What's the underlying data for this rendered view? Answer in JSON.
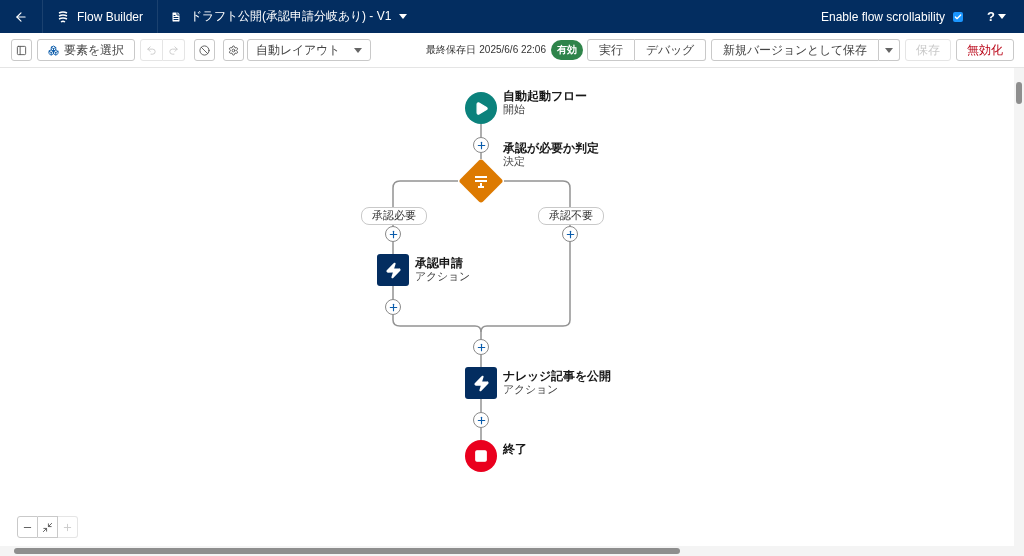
{
  "header": {
    "app_name": "Flow Builder",
    "flow_title": "ドラフト公開(承認申請分岐あり) - V1",
    "scrollability": {
      "label": "Enable flow scrollability",
      "checked": true
    },
    "help": "?"
  },
  "toolbar": {
    "select_button": "要素を選択",
    "undo_disabled": true,
    "redo_disabled": true,
    "layout": "自動レイアウト",
    "last_saved": "最終保存日 2025/6/6 22:06",
    "status": "有効",
    "run": "実行",
    "debug": "デバッグ",
    "save_as_new": "新規バージョンとして保存",
    "save": {
      "label": "保存",
      "disabled": true
    },
    "deactivate": "無効化"
  },
  "flow": {
    "start": {
      "title": "自動起動フロー",
      "subtitle": "開始"
    },
    "decision": {
      "title": "承認が必要か判定",
      "subtitle": "決定",
      "outcomes": [
        {
          "label": "承認必要",
          "steps": [
            {
              "kind": "action",
              "title": "承認申請",
              "subtitle": "アクション"
            }
          ]
        },
        {
          "label": "承認不要"
        }
      ]
    },
    "steps": [
      {
        "kind": "action",
        "title": "ナレッジ記事を公開",
        "subtitle": "アクション"
      },
      {
        "kind": "end",
        "title": "終了"
      }
    ]
  },
  "zoom": {
    "zoom_in_disabled": true
  }
}
